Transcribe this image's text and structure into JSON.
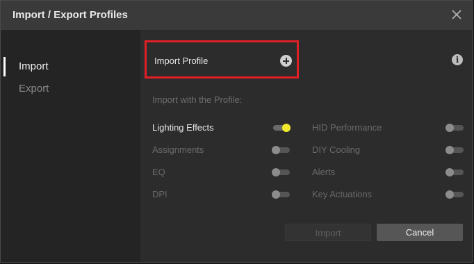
{
  "window": {
    "title": "Import / Export Profiles"
  },
  "sidebar": {
    "items": [
      {
        "label": "Import",
        "active": true
      },
      {
        "label": "Export",
        "active": false
      }
    ]
  },
  "main": {
    "import_profile_label": "Import Profile",
    "section_label": "Import with the Profile:",
    "options": [
      {
        "label": "Lighting Effects",
        "enabled": true
      },
      {
        "label": "Assignments",
        "enabled": false
      },
      {
        "label": "EQ",
        "enabled": false
      },
      {
        "label": "DPI",
        "enabled": false
      },
      {
        "label": "HID Performance",
        "enabled": false
      },
      {
        "label": "DIY Cooling",
        "enabled": false
      },
      {
        "label": "Alerts",
        "enabled": false
      },
      {
        "label": "Key Actuations",
        "enabled": false
      }
    ],
    "buttons": {
      "import": "Import",
      "cancel": "Cancel"
    }
  },
  "icons": {
    "close": "close-icon",
    "add": "plus-circle-icon",
    "info": "info-icon"
  },
  "colors": {
    "highlight_border": "#e01f26",
    "toggle_on": "#f2e82c",
    "background": "#2c2c2c"
  }
}
